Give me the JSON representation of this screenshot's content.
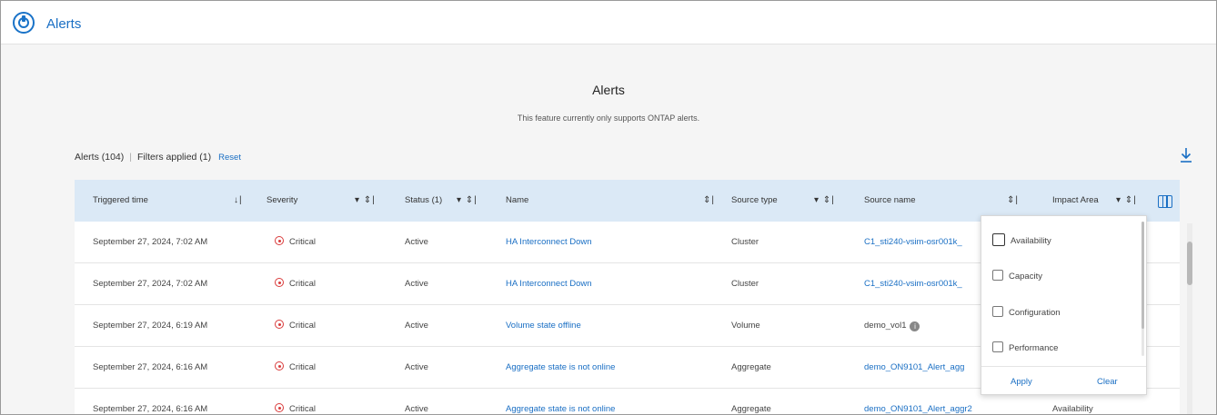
{
  "app": {
    "title": "Alerts"
  },
  "page": {
    "title": "Alerts",
    "subtitle": "This feature currently only supports ONTAP alerts."
  },
  "summary": {
    "count_label": "Alerts (104)",
    "filters_label": "Filters applied (1)",
    "reset_label": "Reset"
  },
  "table": {
    "columns": [
      {
        "label": "Triggered time",
        "controls": "↓|"
      },
      {
        "label": "Severity",
        "controls": "▾ ⇕|"
      },
      {
        "label": "Status (1)",
        "controls": "▾ ⇕|"
      },
      {
        "label": "Name",
        "controls": "⇕|"
      },
      {
        "label": "Source type",
        "controls": "▾ ⇕|"
      },
      {
        "label": "Source name",
        "controls": "⇕|"
      },
      {
        "label": "Impact Area",
        "controls": "▾ ⇕|"
      }
    ],
    "rows": [
      {
        "time": "September 27, 2024, 7:02 AM",
        "severity": "Critical",
        "status": "Active",
        "name": "HA Interconnect Down",
        "source_type": "Cluster",
        "source_name": "C1_sti240-vsim-osr001k_",
        "impact": ""
      },
      {
        "time": "September 27, 2024, 7:02 AM",
        "severity": "Critical",
        "status": "Active",
        "name": "HA Interconnect Down",
        "source_type": "Cluster",
        "source_name": "C1_sti240-vsim-osr001k_",
        "impact": ""
      },
      {
        "time": "September 27, 2024, 6:19 AM",
        "severity": "Critical",
        "status": "Active",
        "name": "Volume state offline",
        "source_type": "Volume",
        "source_name": "demo_vol1",
        "impact": ""
      },
      {
        "time": "September 27, 2024, 6:16 AM",
        "severity": "Critical",
        "status": "Active",
        "name": "Aggregate state is not online",
        "source_type": "Aggregate",
        "source_name": "demo_ON9101_Alert_agg",
        "impact": ""
      },
      {
        "time": "September 27, 2024, 6:16 AM",
        "severity": "Critical",
        "status": "Active",
        "name": "Aggregate state is not online",
        "source_type": "Aggregate",
        "source_name": "demo_ON9101_Alert_aggr2",
        "impact": "Availability"
      }
    ]
  },
  "impact_filter": {
    "options": [
      "Availability",
      "Capacity",
      "Configuration",
      "Performance"
    ],
    "apply_label": "Apply",
    "clear_label": "Clear"
  },
  "colors": {
    "accent": "#1a6fc4",
    "header_bg": "#dbe9f6",
    "critical": "#d93b3b"
  },
  "icons": [
    "app-logo-icon",
    "download-icon",
    "column-chooser-icon",
    "critical-icon",
    "info-icon"
  ]
}
